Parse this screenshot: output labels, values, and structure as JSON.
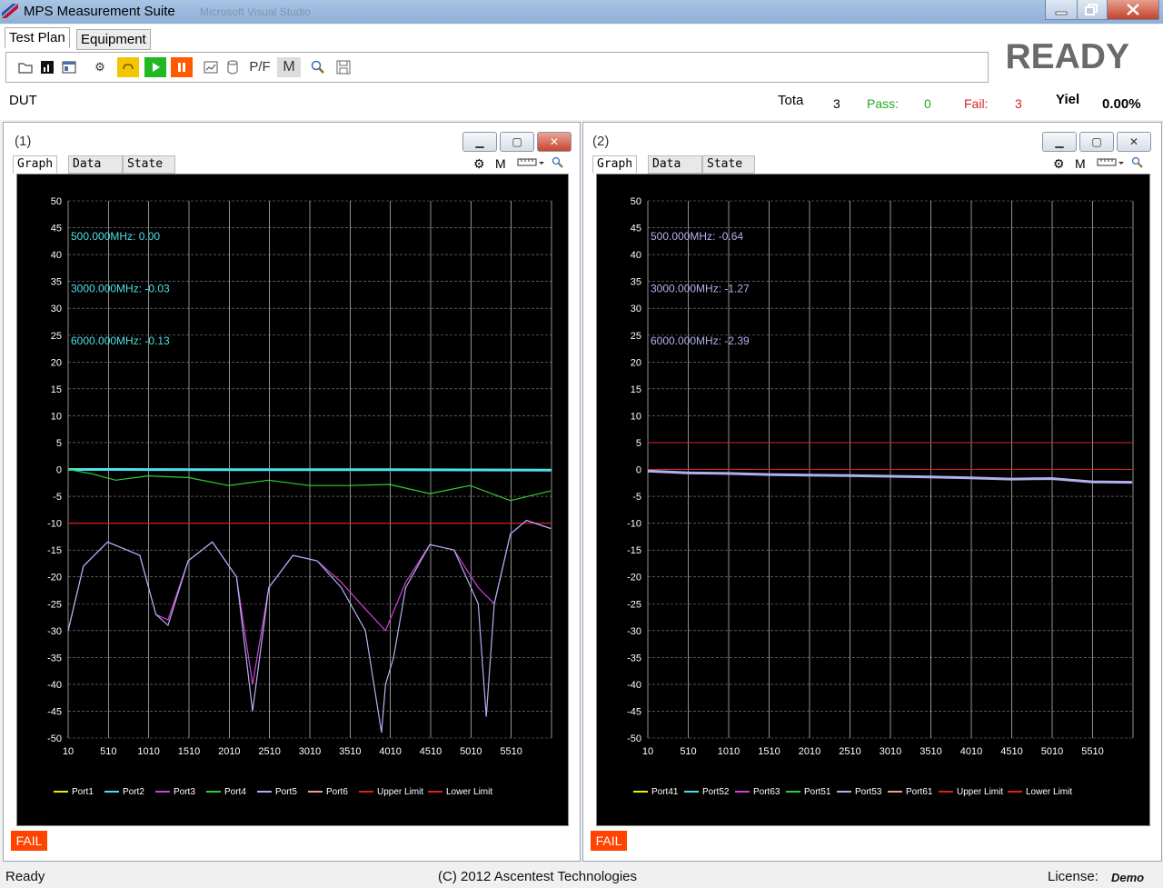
{
  "window": {
    "title": "MPS Measurement Suite",
    "ghost_title": "Microsoft Visual Studio"
  },
  "tabs": [
    {
      "label": "Test Plan",
      "active": true
    },
    {
      "label": "Equipment",
      "active": false
    }
  ],
  "toolbar": {
    "pf_label": "P/F",
    "m_label": "M",
    "icons": [
      "open-folder-icon",
      "chart-icon",
      "window-icon",
      "gear-icon",
      "loop-icon",
      "play-icon",
      "pause-icon",
      "graph-icon",
      "database-icon",
      "zoom-icon",
      "save-icon"
    ]
  },
  "status": {
    "state": "READY",
    "dut_label": "DUT",
    "total_label": "Tota",
    "total_value": "3",
    "pass_label": "Pass:",
    "pass_value": "0",
    "fail_label": "Fail:",
    "fail_value": "3",
    "yield_label": "Yiel",
    "yield_value": "0.00%"
  },
  "colors": {
    "port1": "#f0f000",
    "port2": "#4de0e8",
    "port3": "#d040d8",
    "port4": "#30d030",
    "port5": "#b0b0f0",
    "port6": "#f0a090",
    "upper_limit": "#e02020",
    "lower_limit": "#e02020",
    "fail": "#ff4400",
    "pass_text": "#22aa22",
    "fail_text": "#dd2222"
  },
  "panels": [
    {
      "title": "(1)",
      "tabs": [
        "Graph",
        "Data",
        "State"
      ],
      "tool_m": "M",
      "result": "FAIL",
      "markers": [
        {
          "text": "500.000MHz: 0.00",
          "color": "#4de0e8"
        },
        {
          "text": "3000.000MHz: -0.03",
          "color": "#4de0e8"
        },
        {
          "text": "6000.000MHz: -0.13",
          "color": "#4de0e8"
        }
      ],
      "legend": [
        "Port1",
        "Port2",
        "Port3",
        "Port4",
        "Port5",
        "Port6",
        "Upper Limit",
        "Lower Limit"
      ]
    },
    {
      "title": "(2)",
      "tabs": [
        "Graph",
        "Data",
        "State"
      ],
      "tool_m": "M",
      "result": "FAIL",
      "markers": [
        {
          "text": "500.000MHz: -0.64",
          "color": "#b0b0f0"
        },
        {
          "text": "3000.000MHz: -1.27",
          "color": "#b0b0f0"
        },
        {
          "text": "6000.000MHz: -2.39",
          "color": "#b0b0f0"
        }
      ],
      "legend": [
        "Port41",
        "Port52",
        "Port63",
        "Port51",
        "Port53",
        "Port61",
        "Upper Limit",
        "Lower Limit"
      ]
    }
  ],
  "chart_data": [
    {
      "type": "line",
      "x_ticks": [
        "10",
        "510",
        "1010",
        "1510",
        "2010",
        "2510",
        "3010",
        "3510",
        "4010",
        "4510",
        "5010",
        "5510"
      ],
      "y_ticks": [
        "50",
        "45",
        "40",
        "35",
        "30",
        "25",
        "20",
        "15",
        "10",
        "5",
        "0",
        "-5",
        "-10",
        "-15",
        "-20",
        "-25",
        "-30",
        "-35",
        "-40",
        "-45",
        "-50"
      ],
      "xlim": [
        10,
        6010
      ],
      "ylim": [
        -50,
        50
      ],
      "grid": true,
      "legend_position": "bottom",
      "limits": {
        "upper": -10,
        "lower": -10
      },
      "series": [
        {
          "name": "Port2",
          "color": "#4de0e8",
          "x": [
            10,
            1010,
            2010,
            3010,
            4010,
            5010,
            6010
          ],
          "y": [
            0.0,
            -0.02,
            -0.03,
            -0.03,
            -0.05,
            -0.08,
            -0.13
          ]
        },
        {
          "name": "Port4",
          "color": "#30d030",
          "x": [
            10,
            300,
            600,
            1000,
            1500,
            2000,
            2500,
            3000,
            3500,
            4000,
            4500,
            5000,
            5500,
            6000
          ],
          "y": [
            0,
            -0.8,
            -2,
            -1.2,
            -1.5,
            -3,
            -2,
            -3,
            -3,
            -2.8,
            -4.5,
            -3,
            -5.8,
            -4
          ]
        },
        {
          "name": "Port3",
          "color": "#d040d8",
          "x": [
            10,
            200,
            500,
            900,
            1100,
            1250,
            1500,
            1800,
            2100,
            2300,
            2500,
            2800,
            3100,
            3400,
            3700,
            3950,
            4200,
            4500,
            4800,
            5100,
            5300,
            5500,
            5700,
            6000
          ],
          "y": [
            -30,
            -18,
            -13.5,
            -16,
            -27,
            -28,
            -17,
            -13.5,
            -20,
            -40,
            -22,
            -16,
            -17,
            -21,
            -26,
            -30,
            -21,
            -14,
            -15,
            -22,
            -25,
            -12,
            -9.5,
            -11
          ]
        },
        {
          "name": "Port5",
          "color": "#b0b0f0",
          "x": [
            10,
            200,
            500,
            900,
            1100,
            1250,
            1500,
            1800,
            2100,
            2300,
            2500,
            2800,
            3100,
            3400,
            3700,
            3900,
            3950,
            4050,
            4200,
            4500,
            4800,
            5100,
            5200,
            5300,
            5500,
            5700,
            6000
          ],
          "y": [
            -30,
            -18,
            -13.5,
            -16,
            -27,
            -29,
            -17,
            -13.5,
            -20,
            -45,
            -22,
            -16,
            -17,
            -22,
            -30,
            -49,
            -40,
            -35,
            -22,
            -14,
            -15,
            -25,
            -46,
            -25,
            -12,
            -9.5,
            -11
          ]
        }
      ]
    },
    {
      "type": "line",
      "x_ticks": [
        "10",
        "510",
        "1010",
        "1510",
        "2010",
        "2510",
        "3010",
        "3510",
        "4010",
        "4510",
        "5010",
        "5510"
      ],
      "y_ticks": [
        "50",
        "45",
        "40",
        "35",
        "30",
        "25",
        "20",
        "15",
        "10",
        "5",
        "0",
        "-5",
        "-10",
        "-15",
        "-20",
        "-25",
        "-30",
        "-35",
        "-40",
        "-45",
        "-50"
      ],
      "xlim": [
        10,
        6010
      ],
      "ylim": [
        -50,
        50
      ],
      "grid": true,
      "legend_position": "bottom",
      "limits": {
        "upper": 5,
        "lower": 0
      },
      "series": [
        {
          "name": "Port53",
          "color": "#b0b0f0",
          "x": [
            10,
            500,
            1000,
            1500,
            2000,
            2500,
            3000,
            3500,
            4000,
            4500,
            5000,
            5500,
            6000
          ],
          "y": [
            -0.3,
            -0.64,
            -0.75,
            -0.95,
            -1.05,
            -1.15,
            -1.27,
            -1.4,
            -1.55,
            -1.8,
            -1.7,
            -2.3,
            -2.39
          ]
        }
      ]
    }
  ],
  "statusbar": {
    "left": "Ready",
    "center": "(C) 2012 Ascentest Technologies",
    "license_label": "License:",
    "license_value": "Demo"
  }
}
